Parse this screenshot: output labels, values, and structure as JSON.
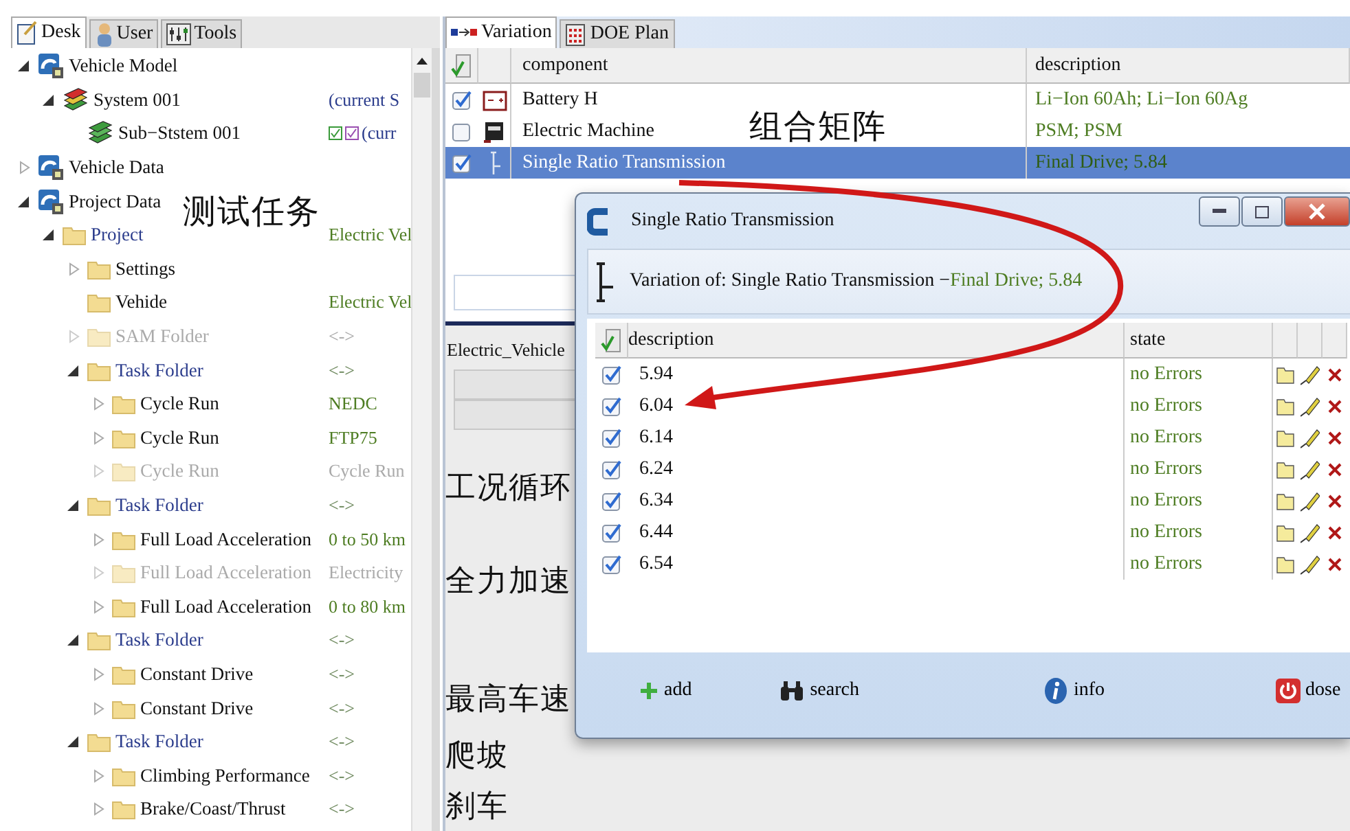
{
  "left_tabs": [
    {
      "label": "Desk",
      "selected": true
    },
    {
      "label": "User",
      "selected": false
    },
    {
      "label": "Tools",
      "selected": false
    }
  ],
  "tree": [
    {
      "label": "Vehicle Model",
      "kind": "tile",
      "expanded": true,
      "children": [
        {
          "label": "System 001",
          "kind": "stack",
          "expanded": true,
          "value": {
            "text": "(current S",
            "kind": "note"
          },
          "children": [
            {
              "label": "Sub−Ststem 001",
              "kind": "stack-green",
              "value": {
                "text": "(curr",
                "kind": "note"
              },
              "check_badges": true
            }
          ]
        }
      ]
    },
    {
      "label": "Vehicle Data",
      "kind": "tile",
      "expanded": false
    },
    {
      "label": "Project Data",
      "kind": "tile",
      "expanded": true,
      "children": [
        {
          "label": "Project",
          "kind": "folder",
          "link": true,
          "expanded": true,
          "value": {
            "text": "Electric Vel",
            "kind": "data"
          },
          "children": [
            {
              "label": "Settings",
              "kind": "folder",
              "expanded": false
            },
            {
              "label": "Vehide",
              "kind": "folder",
              "value": {
                "text": "Electric Vel",
                "kind": "data"
              }
            },
            {
              "label": "SAM Folder",
              "kind": "folder",
              "disabled": true,
              "expanded": false,
              "value": {
                "text": "<->",
                "kind": "arrow"
              }
            },
            {
              "label": "Task Folder",
              "kind": "folder",
              "link": true,
              "expanded": true,
              "value": {
                "text": "<->",
                "kind": "arrow"
              },
              "children": [
                {
                  "label": "Cycle Run",
                  "kind": "folder",
                  "expanded": false,
                  "value": {
                    "text": "NEDC",
                    "kind": "data"
                  }
                },
                {
                  "label": "Cycle Run",
                  "kind": "folder",
                  "expanded": false,
                  "value": {
                    "text": "FTP75",
                    "kind": "data"
                  }
                },
                {
                  "label": "Cycle Run",
                  "kind": "folder",
                  "disabled": true,
                  "expanded": false,
                  "value": {
                    "text": "Cycle Run",
                    "kind": "data"
                  }
                }
              ]
            },
            {
              "label": "Task Folder",
              "kind": "folder",
              "link": true,
              "expanded": true,
              "value": {
                "text": "<->",
                "kind": "arrow"
              },
              "children": [
                {
                  "label": "Full Load Acceleration",
                  "kind": "folder",
                  "expanded": false,
                  "value": {
                    "text": "0 to 50 km",
                    "kind": "data"
                  }
                },
                {
                  "label": "Full Load Acceleration",
                  "kind": "folder",
                  "disabled": true,
                  "expanded": false,
                  "value": {
                    "text": "Electricity",
                    "kind": "data"
                  }
                },
                {
                  "label": "Full Load Acceleration",
                  "kind": "folder",
                  "expanded": false,
                  "value": {
                    "text": "0 to 80 km",
                    "kind": "data"
                  }
                }
              ]
            },
            {
              "label": "Task Folder",
              "kind": "folder",
              "link": true,
              "expanded": true,
              "value": {
                "text": "<->",
                "kind": "arrow"
              },
              "children": [
                {
                  "label": "Constant Drive",
                  "kind": "folder",
                  "expanded": false,
                  "value": {
                    "text": "<->",
                    "kind": "arrow"
                  }
                },
                {
                  "label": "Constant Drive",
                  "kind": "folder",
                  "expanded": false,
                  "value": {
                    "text": "<->",
                    "kind": "arrow"
                  }
                }
              ]
            },
            {
              "label": "Task Folder",
              "kind": "folder",
              "link": true,
              "expanded": true,
              "value": {
                "text": "<->",
                "kind": "arrow"
              },
              "children": [
                {
                  "label": "Climbing Performance",
                  "kind": "folder",
                  "expanded": false,
                  "value": {
                    "text": "<->",
                    "kind": "arrow"
                  }
                },
                {
                  "label": "Brake/Coast/Thrust",
                  "kind": "folder",
                  "expanded": false,
                  "value": {
                    "text": "<->",
                    "kind": "arrow"
                  }
                }
              ]
            }
          ]
        }
      ]
    }
  ],
  "right_tabs": [
    {
      "label": "Variation",
      "selected": true
    },
    {
      "label": "DOE Plan",
      "selected": false
    }
  ],
  "components": {
    "columns": [
      "component",
      "description"
    ],
    "rows": [
      {
        "checked": true,
        "kind": "battery",
        "component": "Battery H",
        "description": "Li−Ion 60Ah; Li−Ion 60Ag",
        "selected": false
      },
      {
        "checked": false,
        "kind": "motor",
        "component": "Electric Machine",
        "description": "PSM; PSM",
        "selected": false
      },
      {
        "checked": true,
        "kind": "shaft",
        "component": "Single Ratio Transmission",
        "description": "Final Drive; 5.84",
        "selected": true
      }
    ]
  },
  "lower_label": "Electric_Vehicle",
  "dialog": {
    "title": "Single Ratio Transmission",
    "subtitle": "Variation of: Single Ratio Transmission −",
    "subtitle_value": "Final Drive; 5.84",
    "columns": [
      "description",
      "state"
    ],
    "rows": [
      {
        "checked": true,
        "description": "5.94",
        "state": "no Errors"
      },
      {
        "checked": true,
        "description": "6.04",
        "state": "no Errors"
      },
      {
        "checked": true,
        "description": "6.14",
        "state": "no Errors"
      },
      {
        "checked": true,
        "description": "6.24",
        "state": "no Errors"
      },
      {
        "checked": true,
        "description": "6.34",
        "state": "no Errors"
      },
      {
        "checked": true,
        "description": "6.44",
        "state": "no Errors"
      },
      {
        "checked": true,
        "description": "6.54",
        "state": "no Errors"
      }
    ],
    "buttons": [
      {
        "kind": "add",
        "label": "add"
      },
      {
        "kind": "search",
        "label": "search"
      },
      {
        "kind": "info",
        "label": "info"
      },
      {
        "kind": "close",
        "label": "dose"
      }
    ]
  },
  "annotations": [
    "测试任务",
    "组合矩阵",
    "工况循环",
    "全力加速",
    "最高车速",
    "爬坡",
    "刹车"
  ]
}
